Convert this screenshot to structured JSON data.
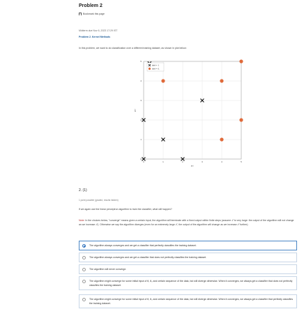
{
  "header": {
    "title": "Problem 2",
    "bookmark_label": "Bookmark this page"
  },
  "meta": {
    "due": "Midterm due Nov 6, 2023 17:29 IST",
    "section": "Problem 2. Kernel Methods",
    "intro": "In this problem, we want to do classification over a different training dataset, as shown in plot below:"
  },
  "question": {
    "number": "2. (1)",
    "points": "1 point possible (graded, results hidden)",
    "prompt": "If we again use the linear perceptron algorithm to train the classifier, what will happen?",
    "note_label": "Note:",
    "note_text": "In the choices below, \"converge\" means given a certain input, the algorithm will terminate with a fixed output within finite steps (assume 𝒯 is very large: the output of the algorithm will not change as we increase 𝒯). Otherwise we say the algorithm diverges (even for an extremely large 𝒯, the output of the algorithm will change as we increase 𝒯 further).",
    "options": [
      {
        "text": "The algorithm always converges and we get a classifier that perfectly classifies the training dataset.",
        "selected": true
      },
      {
        "text": "The algorithm always converges and we get a classifier that does not perfectly classifies the training dataset.",
        "selected": false
      },
      {
        "text": "The algorithm will never converge.",
        "selected": false
      },
      {
        "text": "The algorithm might converge for some initial input of θ, θ₀ and certain sequence of the data, but will diverge otherwise. When it converges, we always get a classifier that does not perfectly classifies the training dataset.",
        "selected": false
      },
      {
        "text": "The algorithm might converge for some initial input of θ, θ₀ and certain sequence of the data, but will diverge otherwise. When it converges, we always get a classifier that perfectly classifies the training dataset.",
        "selected": false
      }
    ]
  },
  "chart_data": {
    "type": "scatter",
    "xlim": [
      0,
      5
    ],
    "ylim": [
      0,
      5
    ],
    "x_ticks": [
      "0",
      "1",
      "2",
      "3",
      "4",
      "5"
    ],
    "y_ticks": [
      "0",
      "1",
      "2",
      "3",
      "4",
      "5"
    ],
    "xlabel": "x⁽¹⁾",
    "ylabel": "x⁽²⁾",
    "grid": true,
    "legend_position": "top-left",
    "series": [
      {
        "name": "label = -1",
        "marker": "x",
        "color": "#111111",
        "points": [
          [
            0,
            0
          ],
          [
            0,
            2
          ],
          [
            1,
            1
          ],
          [
            2,
            0
          ],
          [
            3,
            3
          ],
          [
            0.3,
            4.9
          ]
        ]
      },
      {
        "name": "label = +1",
        "marker": "circle",
        "color": "#e06a3a",
        "points": [
          [
            1,
            4
          ],
          [
            4,
            1
          ],
          [
            4,
            4
          ],
          [
            5,
            2
          ],
          [
            5,
            5
          ]
        ]
      }
    ]
  }
}
